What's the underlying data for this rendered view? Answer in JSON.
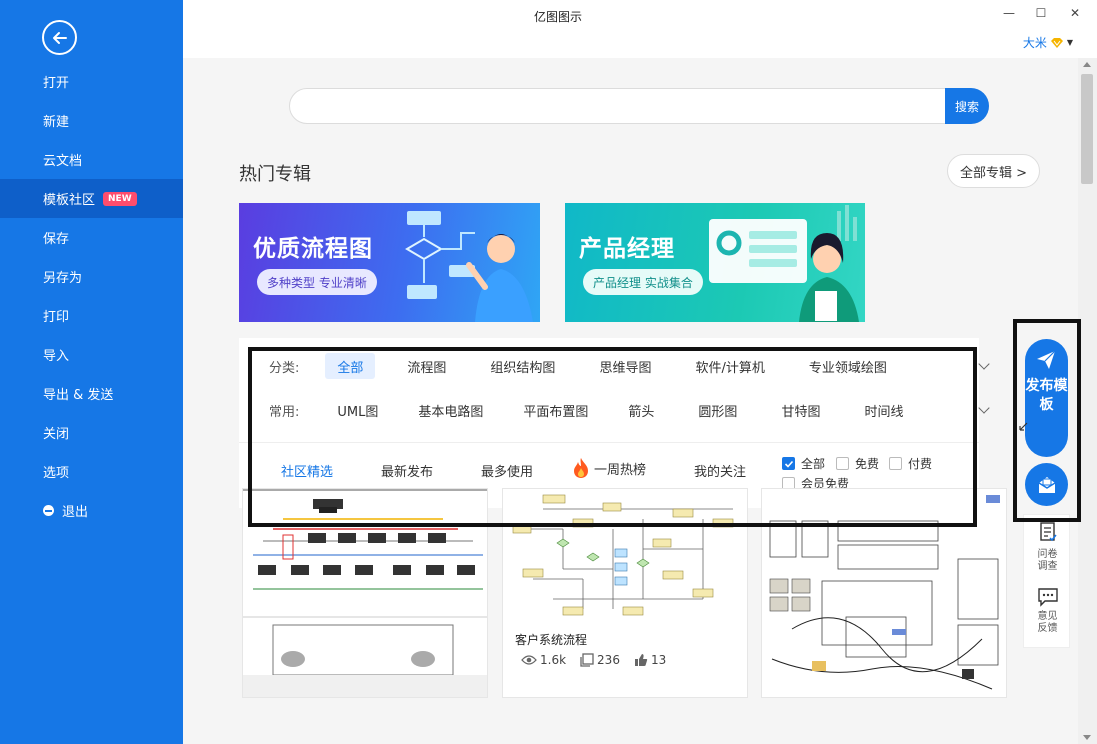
{
  "window": {
    "title": "亿图图示",
    "user_name": "大米",
    "minimize": "—",
    "maximize": "☐",
    "close": "✕"
  },
  "sidebar": {
    "items": [
      {
        "label": "打开"
      },
      {
        "label": "新建"
      },
      {
        "label": "云文档"
      },
      {
        "label": "模板社区",
        "badge": "NEW",
        "active": true
      },
      {
        "label": "保存"
      },
      {
        "label": "另存为"
      },
      {
        "label": "打印"
      },
      {
        "label": "导入"
      },
      {
        "label": "导出 & 发送"
      },
      {
        "label": "关闭"
      },
      {
        "label": "选项"
      },
      {
        "label": "退出"
      }
    ]
  },
  "search": {
    "value": "",
    "placeholder": "",
    "button": "搜索"
  },
  "albums": {
    "title": "热门专辑",
    "all_button": "全部专辑 >",
    "banners": [
      {
        "title": "优质流程图",
        "subtitle": "多种类型 专业清晰"
      },
      {
        "title": "产品经理",
        "subtitle": "产品经理 实战集合"
      }
    ]
  },
  "filters": {
    "category_label": "分类:",
    "categories": [
      "全部",
      "流程图",
      "组织结构图",
      "思维导图",
      "软件/计算机",
      "专业领域绘图"
    ],
    "common_label": "常用:",
    "common": [
      "UML图",
      "基本电路图",
      "平面布置图",
      "箭头",
      "圆形图",
      "甘特图",
      "时间线"
    ],
    "tabs": [
      "社区精选",
      "最新发布",
      "最多使用",
      "一周热榜",
      "我的关注"
    ],
    "checks": [
      {
        "label": "全部",
        "checked": true
      },
      {
        "label": "免费",
        "checked": false
      },
      {
        "label": "付费",
        "checked": false
      },
      {
        "label": "会员免费",
        "checked": false
      }
    ]
  },
  "floating": {
    "publish_label": "发布模板",
    "survey_label": "问卷调查",
    "feedback_label": "意见反馈"
  },
  "cards": [
    {
      "title": "",
      "views": "",
      "favorites": "",
      "likes": ""
    },
    {
      "title": "客户系统流程",
      "views": "1.6k",
      "favorites": "236",
      "likes": "13"
    },
    {
      "title": "",
      "views": "",
      "favorites": "",
      "likes": ""
    }
  ],
  "colors": {
    "accent": "#1677e6",
    "sidebar_active": "#0e5fc9",
    "new_badge": "#ff4d6d"
  }
}
